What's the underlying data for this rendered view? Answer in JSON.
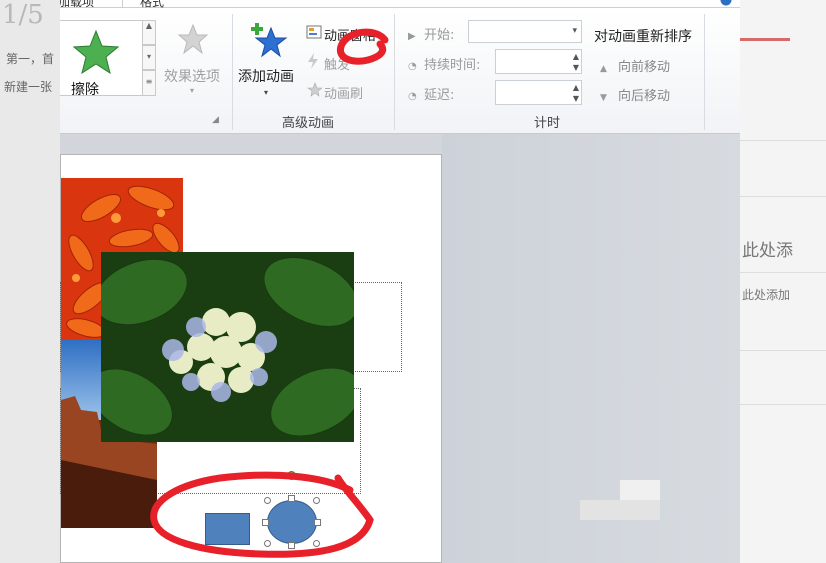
{
  "background": {
    "left_big": "1/5",
    "left_text1": "第一，首",
    "left_text2": "新建一张",
    "right_text1": "此处添",
    "right_text2": "此处添加"
  },
  "tabs": [
    "加载项",
    "格式"
  ],
  "ribbon": {
    "gallery_selected": "擦除",
    "effect_options": "效果选项",
    "add_animation": "添加动画",
    "animation_pane": "动画窗格",
    "trigger": "触发",
    "animation_painter": "动画刷",
    "advanced_group_label": "高级动画",
    "start_label": "开始:",
    "start_value": "",
    "duration_label": "持续时间:",
    "duration_value": "",
    "delay_label": "延迟:",
    "delay_value": "",
    "timing_group_label": "计时",
    "reorder_title": "对动画重新排序",
    "move_earlier": "向前移动",
    "move_later": "向后移动"
  },
  "slide": {
    "images": [
      "orange-flower",
      "hydrangea",
      "desert-rock"
    ],
    "shapes": [
      "rectangle",
      "ellipse"
    ]
  },
  "colors": {
    "shape_fill": "#4f81bd",
    "annotation": "#e8202a",
    "rotate_handle": "#7dc84a"
  },
  "icons": {
    "gallery": "green-star-icon",
    "effect_options": "gray-star-icon",
    "add_animation": "blue-star-plus-icon",
    "animation_pane": "pane-icon",
    "trigger": "lightning-icon",
    "animation_painter": "brush-star-icon"
  }
}
